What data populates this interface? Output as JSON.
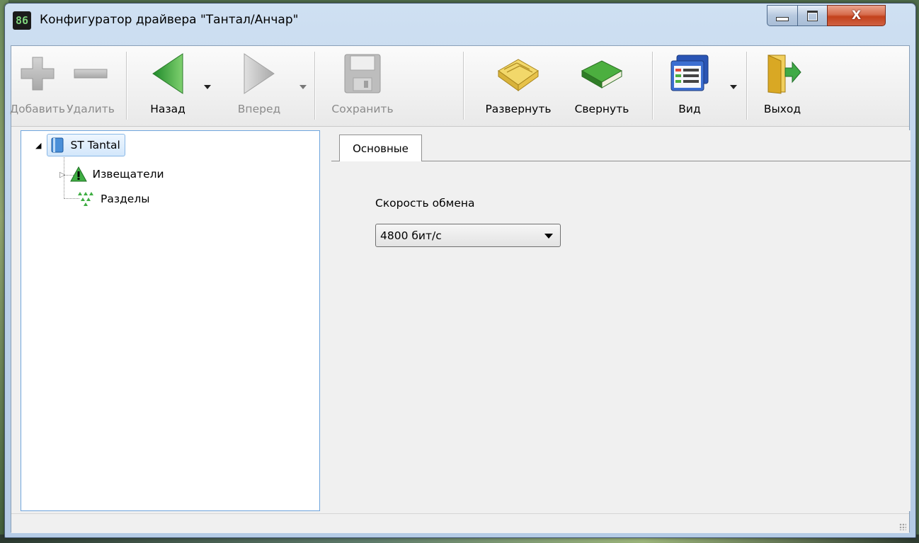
{
  "window": {
    "title": "Конфигуратор драйвера \"Тантал/Анчар\"",
    "app_icon_text": "86"
  },
  "toolbar": {
    "add_label": "Добавить",
    "delete_label": "Удалить",
    "back_label": "Назад",
    "forward_label": "Вперед",
    "save_label": "Сохранить",
    "expand_label": "Развернуть",
    "collapse_label": "Свернуть",
    "view_label": "Вид",
    "exit_label": "Выход"
  },
  "tree": {
    "root_label": "ST Tantal",
    "children": [
      {
        "label": "Извещатели"
      },
      {
        "label": "Разделы"
      }
    ]
  },
  "panel": {
    "tab_label": "Основные",
    "exchange_speed_label": "Скорость обмена",
    "exchange_speed_value": "4800 бит/с"
  },
  "colors": {
    "back_arrow": "#3fae43",
    "disabled_icon": "#b4b4b4",
    "tree_selection": "#d3e7fb",
    "close_button": "#c3411c"
  }
}
